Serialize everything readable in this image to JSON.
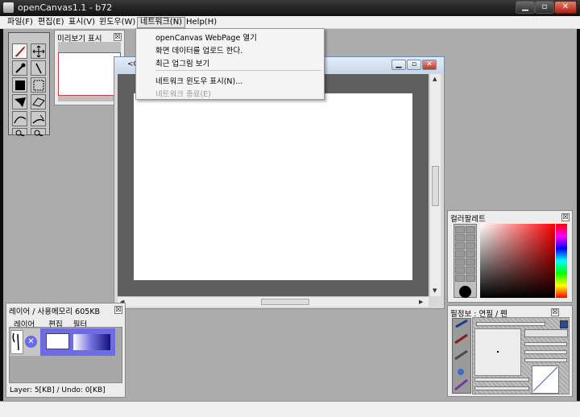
{
  "window": {
    "title": "openCanvas1.1 - b72",
    "buttons": [
      "▁",
      "▫",
      "✕"
    ]
  },
  "menubar": {
    "items": [
      {
        "label": "파일(F)"
      },
      {
        "label": "편집(E)"
      },
      {
        "label": "표시(V)"
      },
      {
        "label": "윈도우(W)"
      },
      {
        "label": "네트워크(N)",
        "active": true
      },
      {
        "label": "Help(H)"
      }
    ]
  },
  "network_menu": {
    "items": [
      {
        "label": "openCanvas WebPage 열기",
        "enabled": true
      },
      {
        "label": "화면 데이터를 업로드 한다.",
        "enabled": true
      },
      {
        "label": "최근 업그림 보기",
        "enabled": true
      },
      {
        "label": "네트워크 윈도우 표시(N)...",
        "enabled": true
      },
      {
        "label": "네트워크 종료(E)",
        "enabled": false
      }
    ]
  },
  "tools": {
    "items": [
      "pen-icon",
      "move-icon",
      "eyedropper-icon",
      "line-icon",
      "black-square-icon",
      "selection-icon",
      "fill-icon",
      "polygon-icon",
      "curve-icon",
      "magic-wand-icon",
      "zoom-in-icon",
      "zoom-out-icon"
    ]
  },
  "preview_panel": {
    "title": "미리보기 표시",
    "close": "☒"
  },
  "canvas_window": {
    "title_fragment": "<C"
  },
  "layer_panel": {
    "title": "레이어 / 사용메모리 605KB",
    "menu": [
      "레이어",
      "편집",
      "필터"
    ],
    "status": "Layer: 5[KB] / Undo: 0[KB]",
    "close": "☒"
  },
  "color_palette": {
    "title": "컬러팔레트",
    "current_color": "#000000",
    "close": "☒"
  },
  "info_panel": {
    "title": "필정보 : 연필  /  펜",
    "close": "☒"
  },
  "colors": {
    "workspace": "#ababab",
    "canvas_bg": "#5f5f5f",
    "selected_layer": "#6e6ce2",
    "menu_active": "#e4e4e4"
  }
}
